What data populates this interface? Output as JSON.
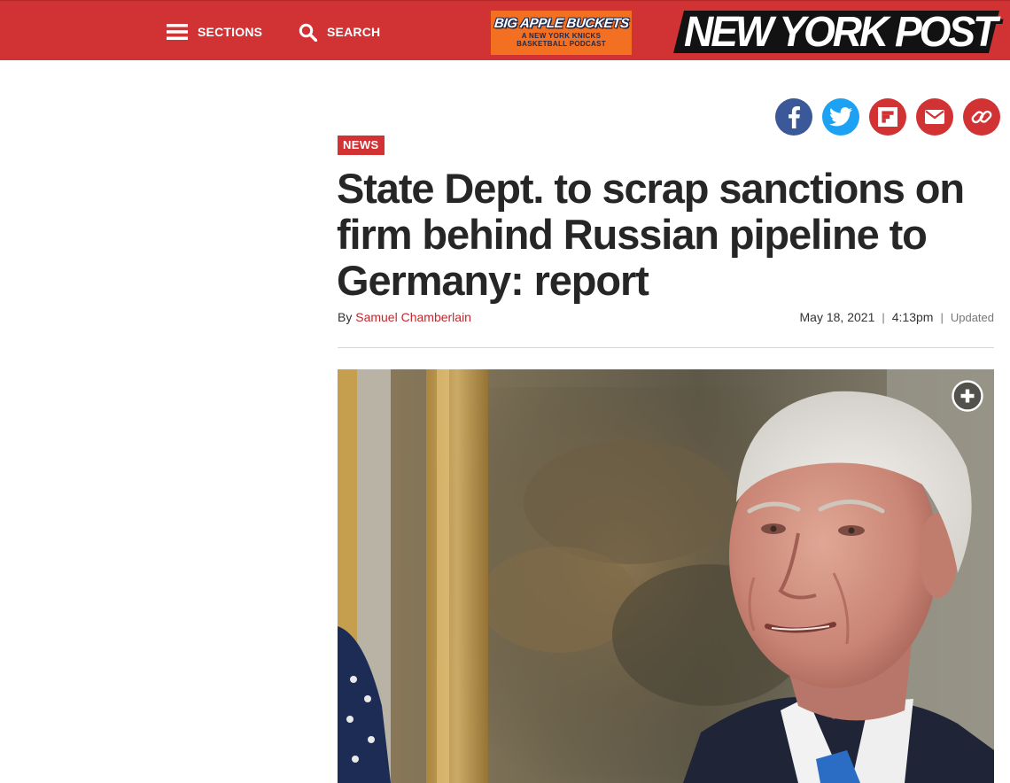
{
  "nav": {
    "sections_label": "SECTIONS",
    "search_label": "SEARCH",
    "podcast_title": "BIG APPLE BUCKETS",
    "podcast_line1": "A NEW YORK KNICKS",
    "podcast_line2": "BASKETBALL PODCAST",
    "logo_text": "NEW YORK POST"
  },
  "share": {
    "icons": [
      "facebook-icon",
      "twitter-icon",
      "flipboard-icon",
      "email-icon",
      "link-icon"
    ],
    "colors": {
      "facebook": "#3b5998",
      "twitter": "#1da1f2",
      "flipboard": "#d13233",
      "email": "#d13233",
      "link": "#d13233"
    }
  },
  "article": {
    "section": "NEWS",
    "headline": "State Dept. to scrap sanctions on firm behind Russian pipeline to Germany: report",
    "byline_prefix": "By",
    "author": "Samuel Chamberlain",
    "date": "May 18, 2021",
    "time": "4:13pm",
    "updated_label": "Updated"
  },
  "image": {
    "expand_icon": "plus-circle-icon"
  },
  "colors": {
    "brand_red": "#d13233",
    "author_red": "#c3272b",
    "headline": "#262626"
  }
}
